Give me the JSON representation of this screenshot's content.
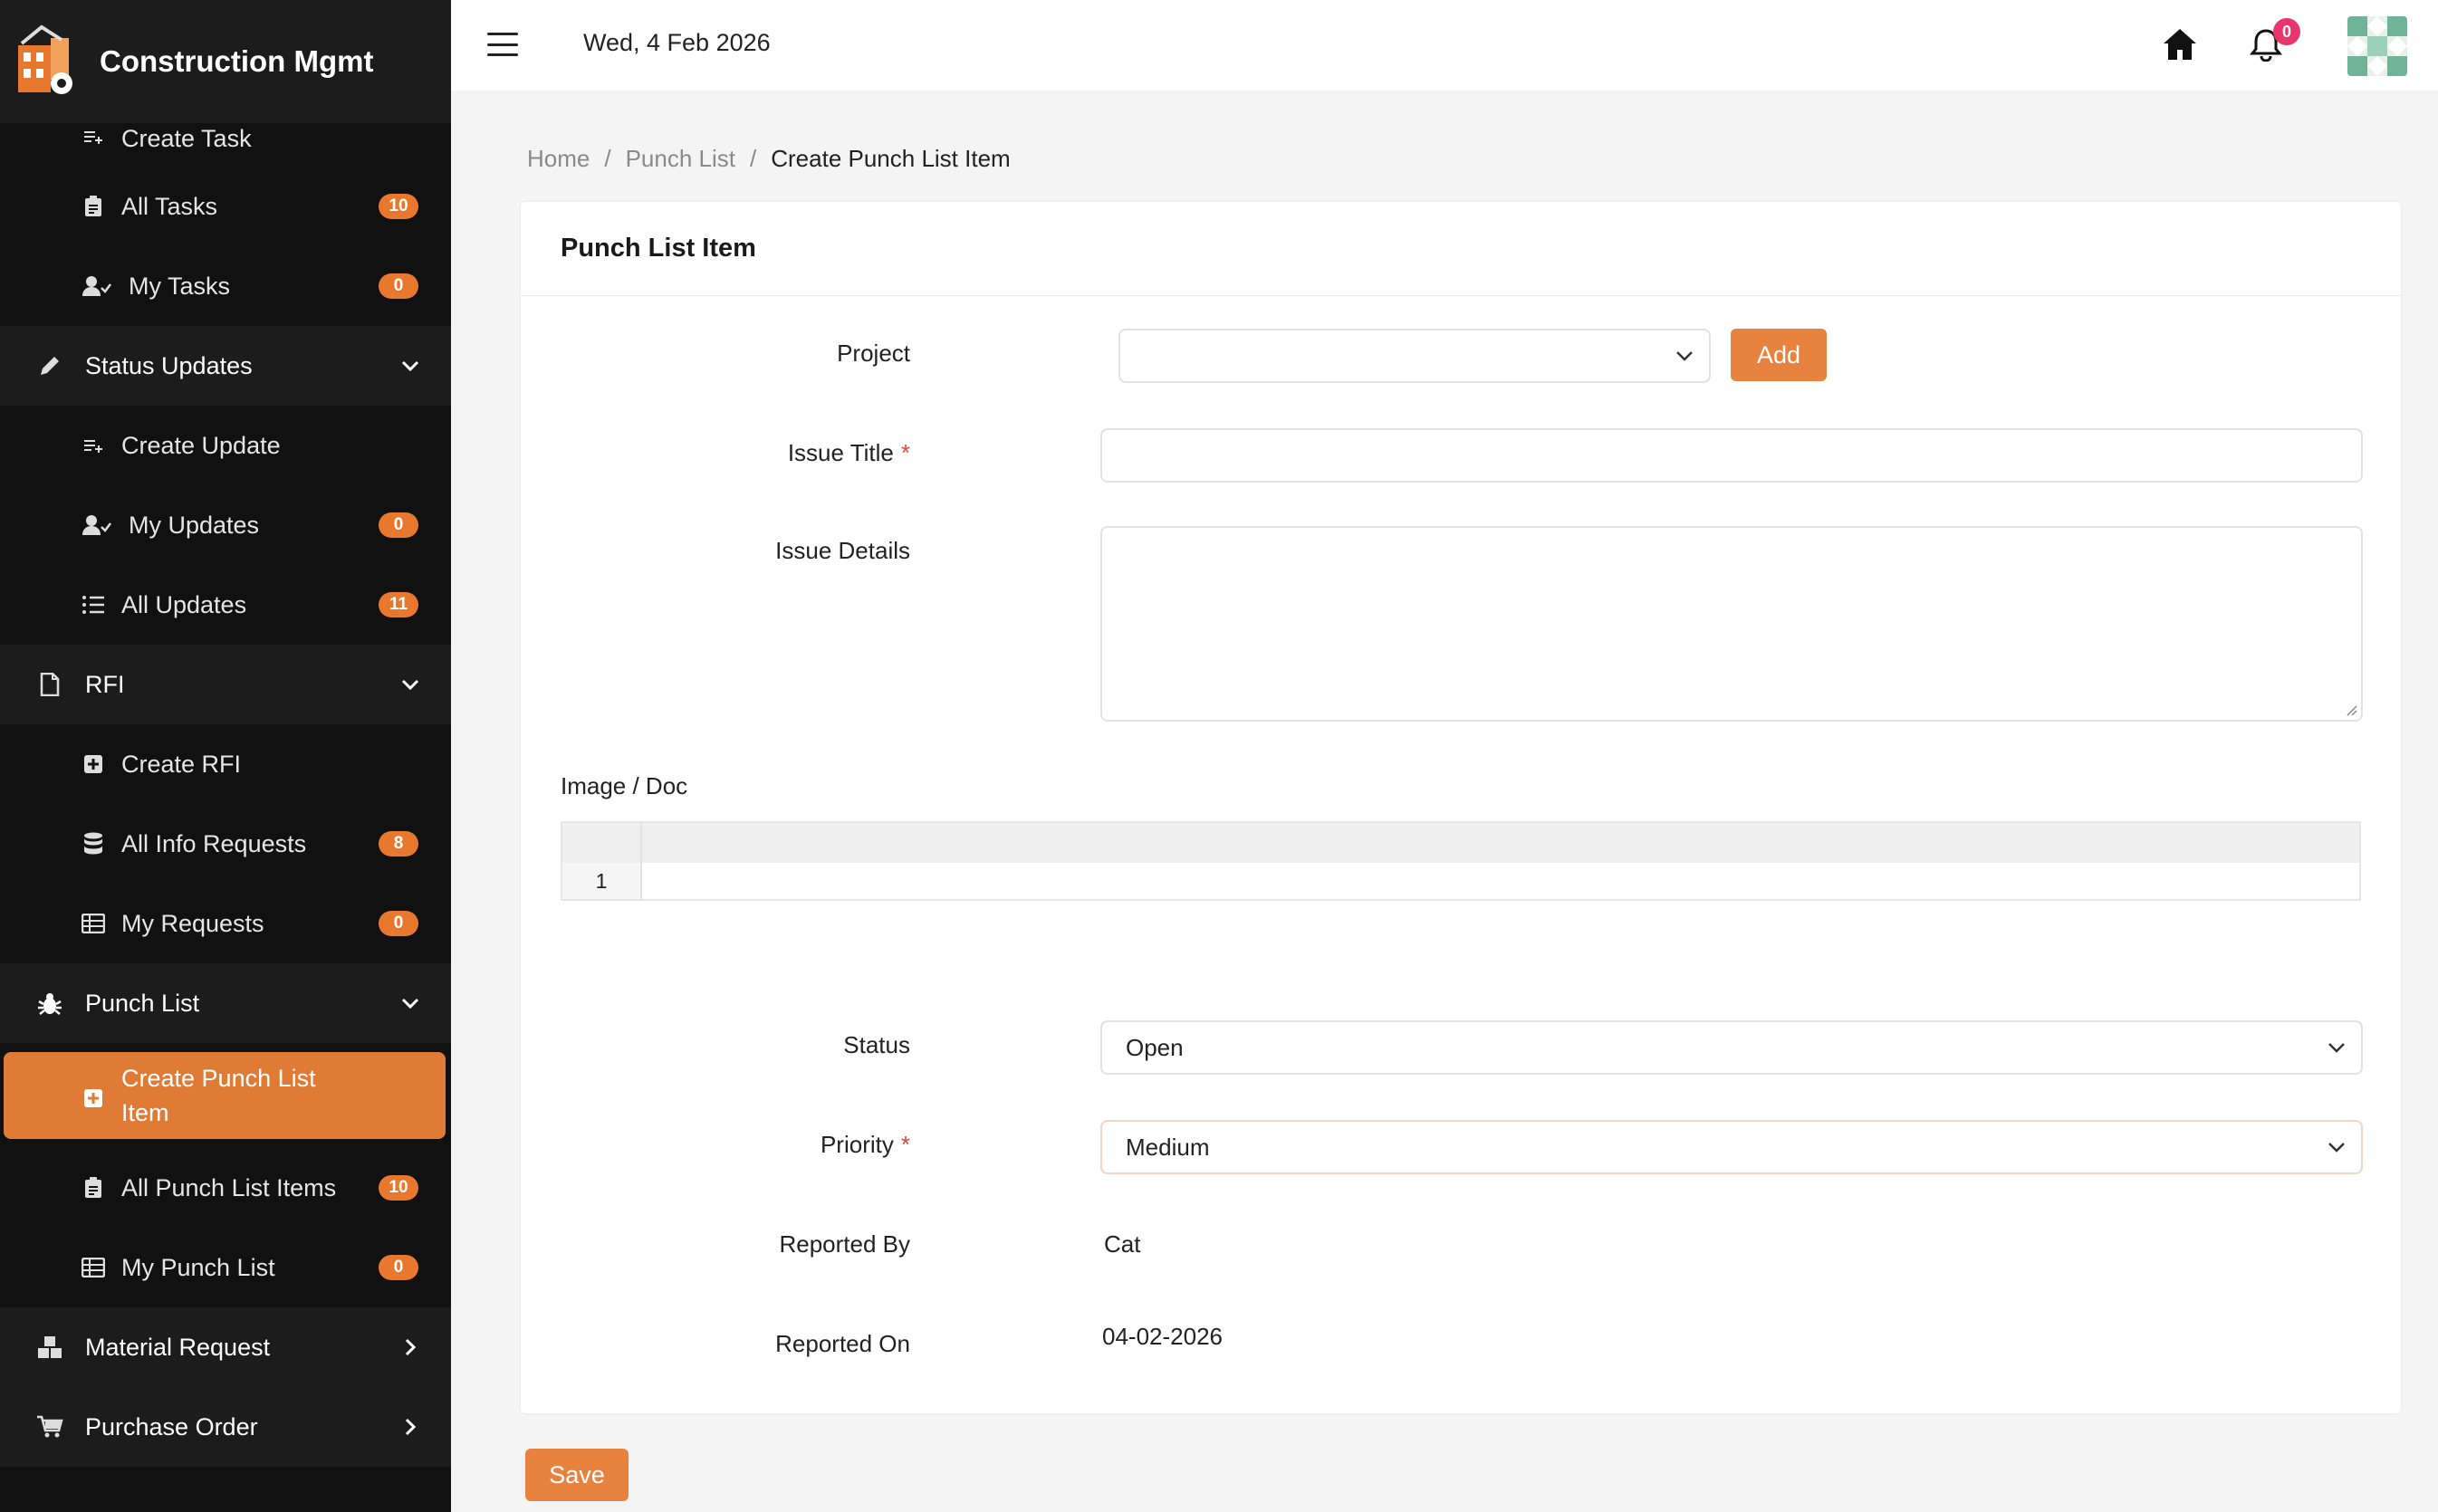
{
  "app": {
    "title": "Construction Mgmt"
  },
  "topbar": {
    "date": "Wed, 4 Feb 2026",
    "notification_count": "0"
  },
  "sidebar": {
    "items": [
      {
        "label": "Create Task",
        "badge": null
      },
      {
        "label": "All Tasks",
        "badge": "10"
      },
      {
        "label": "My Tasks",
        "badge": "0"
      },
      {
        "label": "Status Updates",
        "badge": null
      },
      {
        "label": "Create Update",
        "badge": null
      },
      {
        "label": "My Updates",
        "badge": "0"
      },
      {
        "label": "All Updates",
        "badge": "11"
      },
      {
        "label": "RFI",
        "badge": null
      },
      {
        "label": "Create RFI",
        "badge": null
      },
      {
        "label": "All Info Requests",
        "badge": "8"
      },
      {
        "label": "My Requests",
        "badge": "0"
      },
      {
        "label": "Punch List",
        "badge": null
      },
      {
        "label": "Create Punch List Item",
        "badge": null
      },
      {
        "label": "All Punch List Items",
        "badge": "10"
      },
      {
        "label": "My Punch List",
        "badge": "0"
      },
      {
        "label": "Material Request",
        "badge": null
      },
      {
        "label": "Purchase Order",
        "badge": null
      }
    ]
  },
  "breadcrumb": {
    "home": "Home",
    "section": "Punch List",
    "current": "Create Punch List Item"
  },
  "form": {
    "title": "Punch List Item",
    "project_label": "Project",
    "project_value": "",
    "add_label": "Add",
    "issue_title_label": "Issue Title",
    "issue_title_value": "",
    "issue_details_label": "Issue Details",
    "issue_details_value": "",
    "image_doc_label": "Image / Doc",
    "image_doc_row_number": "1",
    "status_label": "Status",
    "status_value": "Open",
    "priority_label": "Priority",
    "priority_value": "Medium",
    "reported_by_label": "Reported By",
    "reported_by_value": "Cat",
    "reported_on_label": "Reported On",
    "reported_on_value": "04-02-2026",
    "required_marker": "*",
    "save_label": "Save"
  },
  "colors": {
    "accent": "#e8823f",
    "sidebar_bg": "#111111",
    "notification_badge": "#e9356d"
  }
}
